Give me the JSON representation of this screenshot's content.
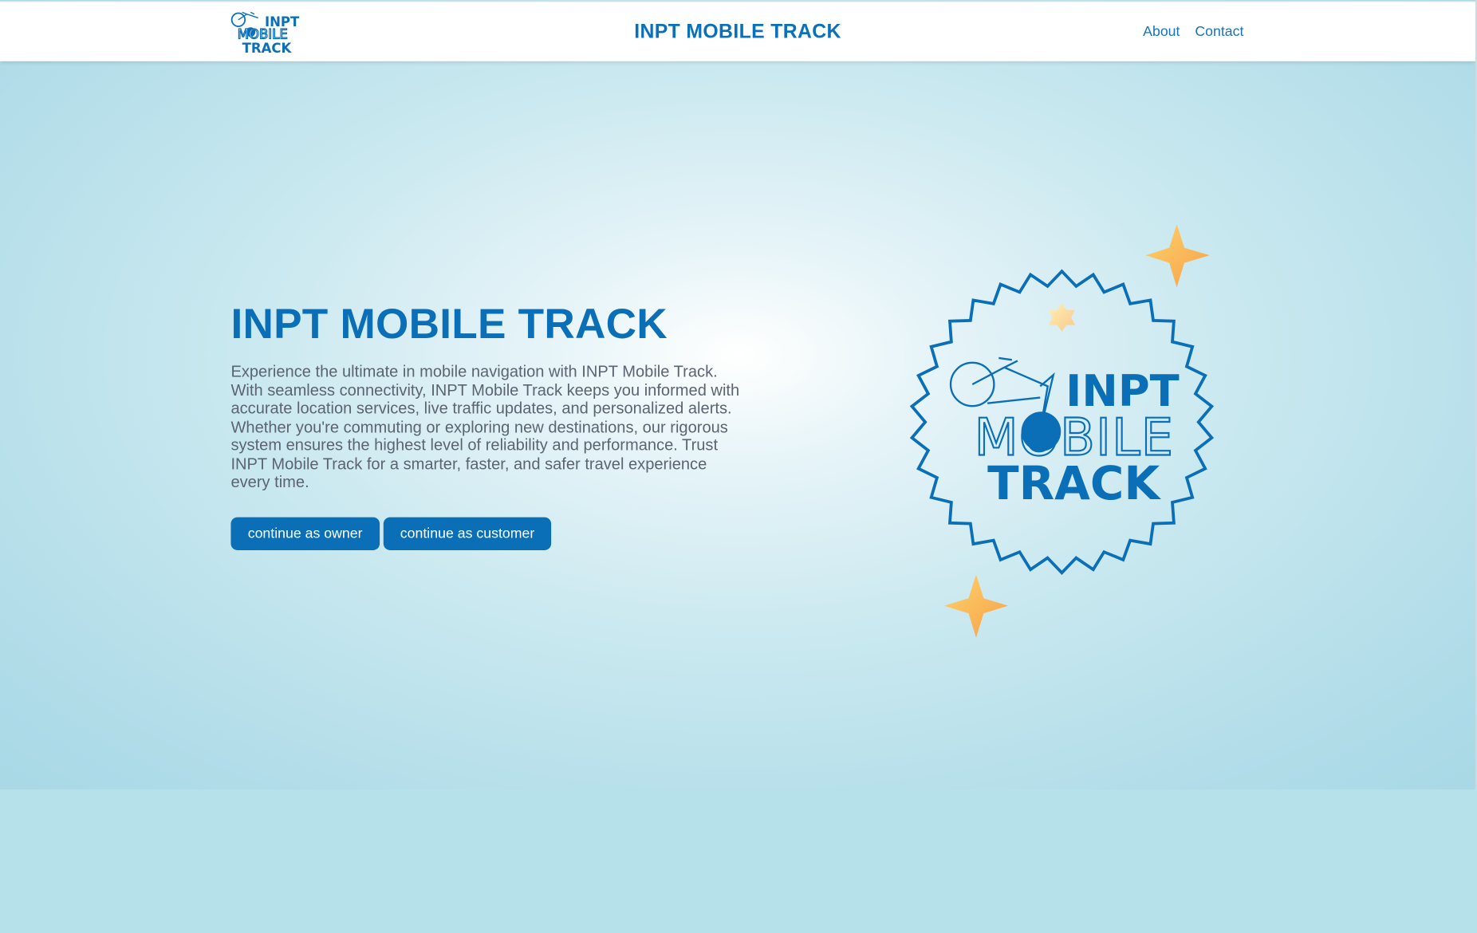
{
  "navbar": {
    "title": "INPT MOBILE TRACK",
    "links": [
      {
        "label": "About"
      },
      {
        "label": "Contact"
      }
    ],
    "logo_text": [
      "INPT",
      "MOBILE",
      "TRACK"
    ]
  },
  "hero": {
    "title": "INPT MOBILE TRACK",
    "description": "Experience the ultimate in mobile navigation with INPT Mobile Track. With seamless connectivity, INPT Mobile Track keeps you informed with accurate location services, live traffic updates, and personalized alerts. Whether you're commuting or exploring new destinations, our rigorous system ensures the highest level of reliability and performance. Trust INPT Mobile Track for a smarter, faster, and safer travel experience every time.",
    "buttons": {
      "owner": "continue as owner",
      "customer": "continue as customer"
    }
  },
  "badge": {
    "text": [
      "INPT",
      "MOBILE",
      "TRACK"
    ]
  },
  "colors": {
    "brand": "#0b6fb7",
    "star": "#f8a640",
    "background": "#cbe9f0"
  }
}
